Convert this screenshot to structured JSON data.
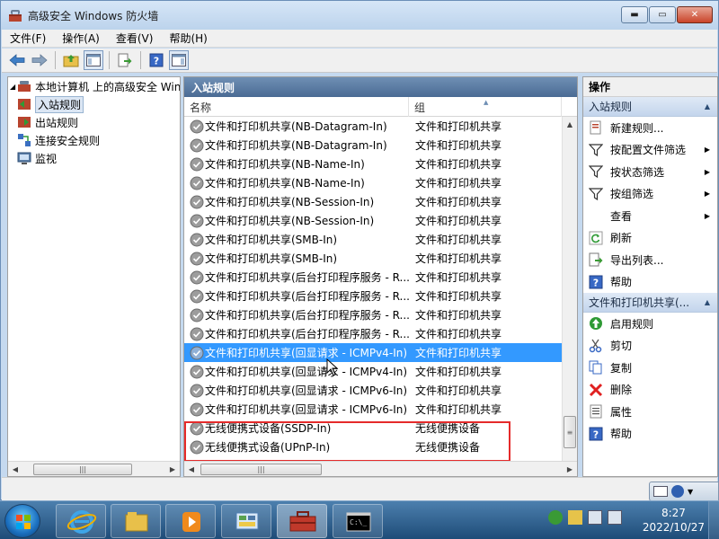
{
  "window": {
    "title": "高级安全 Windows 防火墙",
    "controls": {
      "minimize": "▬",
      "maximize": "▭",
      "close": "✕"
    }
  },
  "menu": [
    {
      "label": "文件(F)"
    },
    {
      "label": "操作(A)"
    },
    {
      "label": "查看(V)"
    },
    {
      "label": "帮助(H)"
    }
  ],
  "tree": {
    "root": "本地计算机 上的高级安全 Windows 防火墙",
    "items": [
      {
        "label": "入站规则",
        "selected": true
      },
      {
        "label": "出站规则"
      },
      {
        "label": "连接安全规则"
      },
      {
        "label": "监视"
      }
    ]
  },
  "center": {
    "header": "入站规则",
    "columns": {
      "name": "名称",
      "group": "组"
    },
    "rows": [
      {
        "name": "文件和打印机共享(NB-Datagram-In)",
        "group": "文件和打印机共享"
      },
      {
        "name": "文件和打印机共享(NB-Datagram-In)",
        "group": "文件和打印机共享"
      },
      {
        "name": "文件和打印机共享(NB-Name-In)",
        "group": "文件和打印机共享"
      },
      {
        "name": "文件和打印机共享(NB-Name-In)",
        "group": "文件和打印机共享"
      },
      {
        "name": "文件和打印机共享(NB-Session-In)",
        "group": "文件和打印机共享"
      },
      {
        "name": "文件和打印机共享(NB-Session-In)",
        "group": "文件和打印机共享"
      },
      {
        "name": "文件和打印机共享(SMB-In)",
        "group": "文件和打印机共享"
      },
      {
        "name": "文件和打印机共享(SMB-In)",
        "group": "文件和打印机共享"
      },
      {
        "name": "文件和打印机共享(后台打印程序服务 - R...",
        "group": "文件和打印机共享"
      },
      {
        "name": "文件和打印机共享(后台打印程序服务 - R...",
        "group": "文件和打印机共享"
      },
      {
        "name": "文件和打印机共享(后台打印程序服务 - R...",
        "group": "文件和打印机共享"
      },
      {
        "name": "文件和打印机共享(后台打印程序服务 - R...",
        "group": "文件和打印机共享"
      },
      {
        "name": "文件和打印机共享(回显请求 - ICMPv4-In)",
        "group": "文件和打印机共享",
        "selected": true
      },
      {
        "name": "文件和打印机共享(回显请求 - ICMPv4-In)",
        "group": "文件和打印机共享"
      },
      {
        "name": "文件和打印机共享(回显请求 - ICMPv6-In)",
        "group": "文件和打印机共享"
      },
      {
        "name": "文件和打印机共享(回显请求 - ICMPv6-In)",
        "group": "文件和打印机共享"
      },
      {
        "name": "无线便携式设备(SSDP-In)",
        "group": "无线便携设备"
      },
      {
        "name": "无线便携式设备(UPnP-In)",
        "group": "无线便携设备"
      }
    ]
  },
  "actions": {
    "title": "操作",
    "section1": "入站规则",
    "section1_items": [
      {
        "label": "新建规则...",
        "icon": "new-rule-icon"
      },
      {
        "label": "按配置文件筛选",
        "icon": "filter-icon",
        "submenu": true
      },
      {
        "label": "按状态筛选",
        "icon": "filter-icon",
        "submenu": true
      },
      {
        "label": "按组筛选",
        "icon": "filter-icon",
        "submenu": true
      },
      {
        "label": "查看",
        "icon": "",
        "submenu": true
      },
      {
        "label": "刷新",
        "icon": "refresh-icon"
      },
      {
        "label": "导出列表...",
        "icon": "export-icon"
      },
      {
        "label": "帮助",
        "icon": "help-icon"
      }
    ],
    "section2": "文件和打印机共享(...",
    "section2_items": [
      {
        "label": "启用规则",
        "icon": "enable-icon"
      },
      {
        "label": "剪切",
        "icon": "cut-icon"
      },
      {
        "label": "复制",
        "icon": "copy-icon"
      },
      {
        "label": "删除",
        "icon": "delete-icon"
      },
      {
        "label": "属性",
        "icon": "properties-icon"
      },
      {
        "label": "帮助",
        "icon": "help-icon"
      }
    ]
  },
  "taskbar": {
    "time": "8:27",
    "date": "2022/10/27"
  },
  "colors": {
    "selection": "#3399ff",
    "highlight_border": "#e52b2b",
    "pane_header": "#4a6b94"
  }
}
